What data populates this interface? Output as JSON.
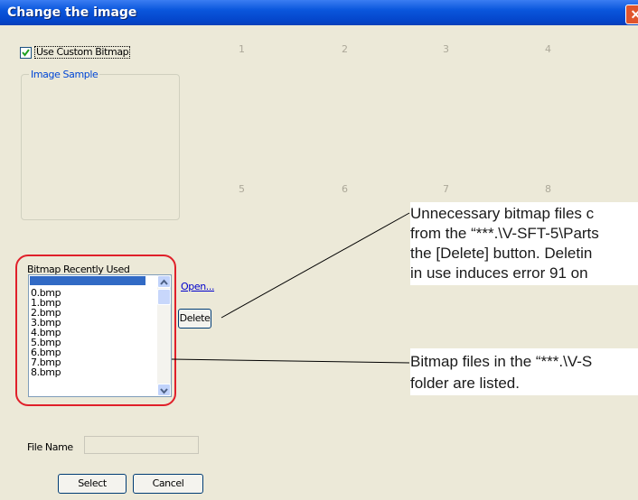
{
  "window": {
    "title": "Change the image",
    "close_glyph": "✕"
  },
  "options": {
    "use_custom_bitmap_label": "Use Custom Bitmap",
    "use_custom_bitmap_checked": true
  },
  "image_sample": {
    "label": "Image Sample"
  },
  "grid_numbers": [
    "1",
    "2",
    "3",
    "4",
    "5",
    "6",
    "7",
    "8"
  ],
  "recent": {
    "label": "Bitmap Recently Used",
    "items": [
      "0.bmp",
      "1.bmp",
      "2.bmp",
      "3.bmp",
      "4.bmp",
      "5.bmp",
      "6.bmp",
      "7.bmp",
      "8.bmp"
    ],
    "open_label": "Open...",
    "delete_label": "Delete"
  },
  "file": {
    "label": "File Name",
    "value": ""
  },
  "actions": {
    "select_label": "Select",
    "cancel_label": "Cancel"
  },
  "callouts": {
    "delete_note": [
      "Unnecessary bitmap files c",
      "from the “***.\\V-SFT-5\\Parts",
      "the [Delete] button.  Deletin",
      "in use induces error 91 on"
    ],
    "list_note": [
      "Bitmap files in the “***.\\V-S",
      "folder are listed."
    ]
  },
  "colors": {
    "titlebar": "#0a56dc",
    "highlight_ring": "#e0202a",
    "selection": "#316ac5",
    "link": "#0000cc"
  }
}
